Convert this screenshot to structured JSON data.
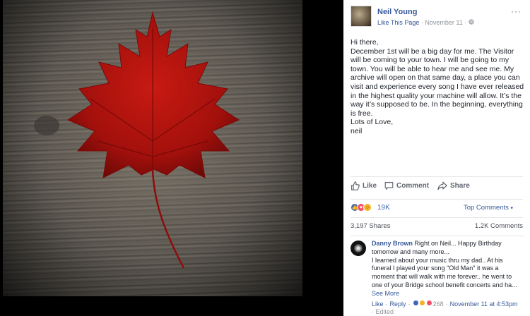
{
  "photo": {
    "leaf_color": "#b5120f"
  },
  "post": {
    "author": "Neil Young",
    "like_page": "Like This Page",
    "dot": "·",
    "date": "November 11",
    "globe_icon": "globe-icon",
    "more_icon": "···",
    "body": [
      "Hi there,",
      "December 1st will be a big day for me. The Visitor will be coming to your town. I will be going to my town. You will be able to hear me and see me. My archive will open on that same day, a place you can visit and experience every song I have ever released in the highest quality your machine will allow. It’s the way it’s supposed to be. In the beginning, everything is free.",
      "Lots of Love,",
      "neil"
    ],
    "actions": {
      "like": "Like",
      "comment": "Comment",
      "share": "Share"
    },
    "reactions": {
      "count": "19K",
      "top_comments": "Top Comments",
      "caret": "▾"
    },
    "shares": "3,197 Shares",
    "comments_count": "1.2K Comments"
  },
  "comment": {
    "author": "Danny Brown",
    "text_first": "Right on Neil... Happy Birthday tomorrow and many more...",
    "text_rest": "I learned about your music thru my dad.. At his funeral I played your song \"Old Man\" it was a moment that will walk with me forever.. he went to one of your Bridge school benefit concerts and ha...",
    "see_more": "See More",
    "like": "Like",
    "reply": "Reply",
    "dot": "·",
    "reaction_count": "268",
    "date": "November 11 at 4:53pm",
    "edited": "Edited"
  },
  "colors": {
    "link": "#365899",
    "like_blue": "#4267b2",
    "love_red": "#f25268",
    "wow_yellow": "#f7b125"
  }
}
